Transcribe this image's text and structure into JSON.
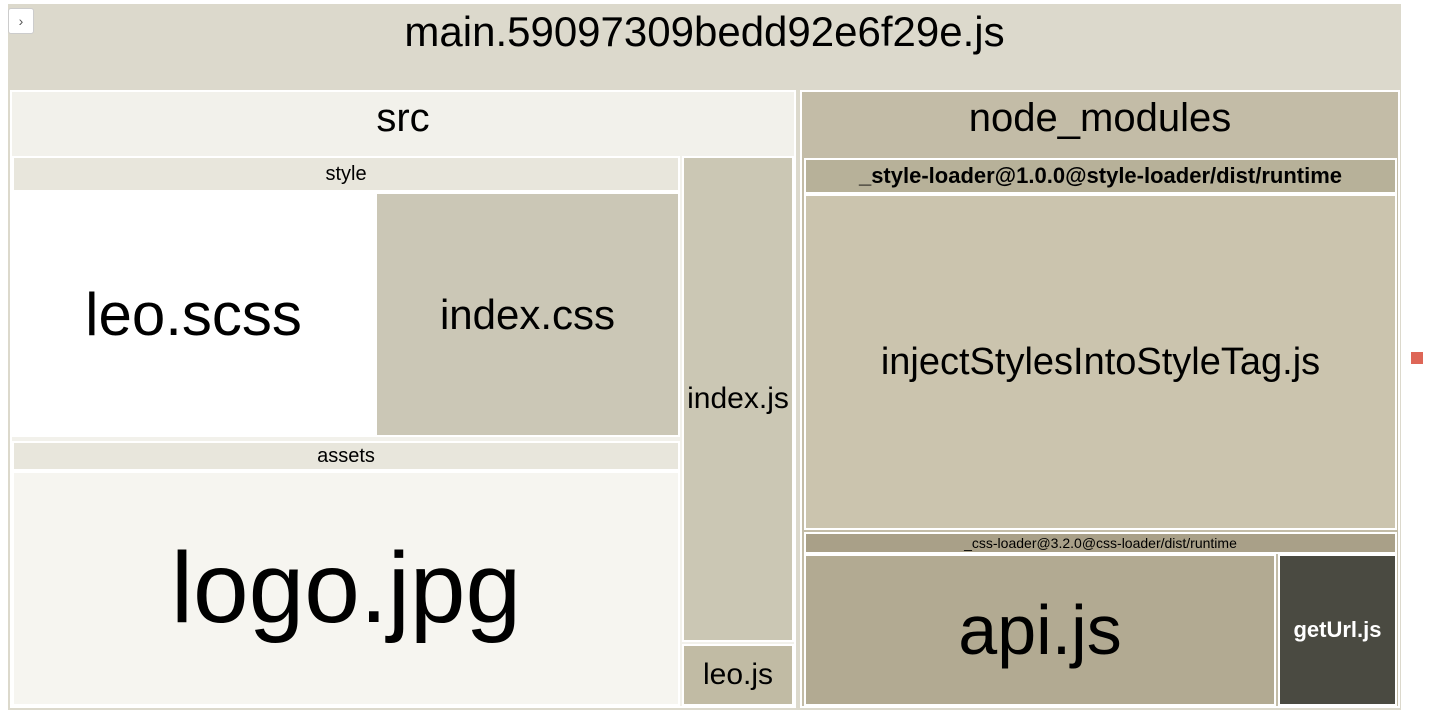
{
  "toggle_glyph": "›",
  "bundle": "main.59097309bedd92e6f29e.js",
  "src": {
    "label": "src",
    "style": {
      "label": "style",
      "leo_scss": "leo.scss",
      "index_css": "index.css"
    },
    "assets": {
      "label": "assets",
      "logo_jpg": "logo.jpg"
    },
    "index_js": "index.js",
    "leo_js": "leo.js"
  },
  "node_modules": {
    "label": "node_modules",
    "style_loader_runtime": {
      "label": "_style-loader@1.0.0@style-loader/dist/runtime",
      "inject": "injectStylesIntoStyleTag.js"
    },
    "css_loader_runtime": {
      "label": "_css-loader@3.2.0@css-loader/dist/runtime",
      "api_js": "api.js",
      "geturl_js": "getUrl.js"
    }
  },
  "colors": {
    "bundle_bg": "#dcd9cc",
    "src_bg": "#f2f1eb",
    "style_header_bg": "#e8e6dc",
    "leo_scss_bg": "#ffffff",
    "index_css_bg": "#cbc7b6",
    "assets_header_bg": "#e8e6dc",
    "logo_bg": "#f6f5f0",
    "index_js_bg": "#cbc7b4",
    "leo_js_bg": "#c1bba4",
    "node_modules_bg": "#c3bca7",
    "style_loader_header_bg": "#b7b199",
    "inject_bg": "#cbc4ae",
    "css_loader_header_bg": "#a9a088",
    "api_js_bg": "#b2aa92",
    "geturl_js_bg": "#4a4a41"
  }
}
